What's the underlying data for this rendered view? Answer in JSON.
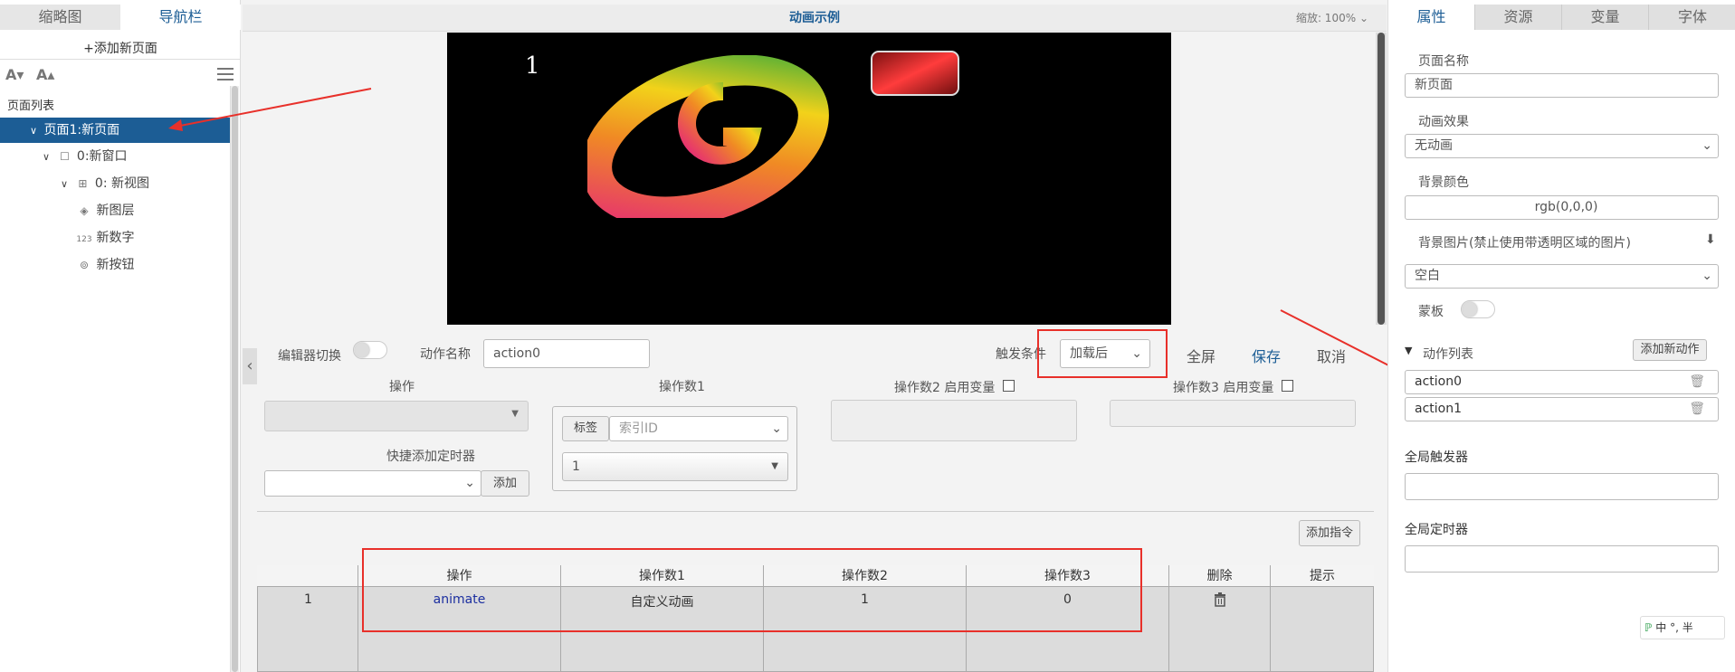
{
  "left_panel": {
    "tabs": [
      "缩略图",
      "导航栏"
    ],
    "add_page": "+添加新页面",
    "font_decrease": "A▾",
    "font_increase": "A▴",
    "page_list_title": "页面列表",
    "tree": [
      {
        "label": "页面1:新页面",
        "icon": "chevron-down-icon"
      },
      {
        "label": "0:新窗口",
        "icon": "window-icon"
      },
      {
        "label": "0: 新视图",
        "icon": "view-icon"
      },
      {
        "label": "新图层",
        "icon": "layers-icon"
      },
      {
        "label": "新数字",
        "icon": "number-icon",
        "icon_glyph": "123"
      },
      {
        "label": "新按钮",
        "icon": "button-icon"
      }
    ]
  },
  "center": {
    "title": "动画示例",
    "zoom": "缩放: 100%",
    "canvas_text": "1",
    "canvas_bg": "#000000",
    "editor": {
      "editor_toggle_label": "编辑器切换",
      "action_name_label": "动作名称",
      "action_name_value": "action0",
      "trigger_label": "触发条件",
      "trigger_value": "加载后",
      "fullscreen": "全屏",
      "save": "保存",
      "cancel": "取消",
      "op_label": "操作",
      "operand1_label": "操作数1",
      "operand2_label": "操作数2 启用变量",
      "operand3_label": "操作数3 启用变量",
      "quick_timer_label": "快捷添加定时器",
      "add_button": "添加",
      "tag_button": "标签",
      "index_placeholder": "索引ID",
      "index_value": "1",
      "add_command": "添加指令"
    },
    "table": {
      "columns": [
        "",
        "操作",
        "操作数1",
        "操作数2",
        "操作数3",
        "删除",
        "提示"
      ],
      "rows": [
        {
          "index": "1",
          "op": "animate",
          "operand1": "自定义动画",
          "operand2": "1",
          "operand3": "0"
        }
      ]
    }
  },
  "right_panel": {
    "tabs": [
      "属性",
      "资源",
      "变量",
      "字体"
    ],
    "page_name_label": "页面名称",
    "page_name_value": "新页面",
    "anim_label": "动画效果",
    "anim_value": "无动画",
    "bg_color_label": "背景颜色",
    "bg_color_value": "rgb(0,0,0)",
    "bg_image_label": "背景图片(禁止使用带透明区域的图片)",
    "bg_image_value": "空白",
    "mask_label": "蒙板",
    "action_list_label": "动作列表",
    "add_action": "添加新动作",
    "actions": [
      "action0",
      "action1"
    ],
    "global_trigger_label": "全局触发器",
    "global_timer_label": "全局定时器",
    "ime": "中 °, 半"
  },
  "colors": {
    "accent": "#1c5d95",
    "highlight": "#e8302a"
  }
}
